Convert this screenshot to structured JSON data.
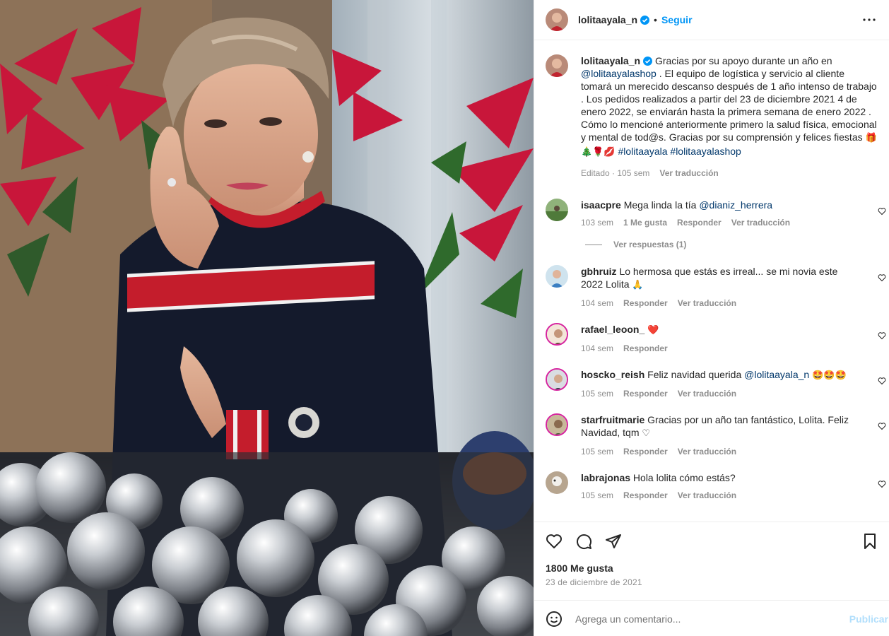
{
  "post": {
    "author": "lolitaayala_n",
    "follow_label": "Seguir",
    "separator": "•",
    "verified_icon": "verified-badge-icon",
    "more_icon": "more-options-icon"
  },
  "caption": {
    "username": "lolitaayala_n",
    "text_1": "Gracias por su apoyo durante un año en",
    "mention_1": "@lolitaayalashop",
    "text_2": ". El equipo de logística y servicio al cliente tomará un merecido descanso después de 1 año intenso de trabajo . Los pedidos realizados a partir del 23 de diciembre 2021 4 de enero 2022, se enviarán hasta la primera semana de enero 2022 . Cómo lo mencioné anteriormente primero la salud física, emocional y mental de tod@s. Gracias por su comprensión y felices fiestas",
    "emojis": "🎁🎄🌹💋",
    "hashtag_1": "#lolitaayala",
    "hashtag_2": "#lolitaayalashop",
    "edited": "Editado · 105 sem",
    "translate": "Ver traducción"
  },
  "comments": [
    {
      "username": "isaacpre",
      "text": "Mega linda la tía",
      "mention": "@dianiz_herrera",
      "emoji": "",
      "time": "103 sem",
      "likes": "1 Me gusta",
      "reply": "Responder",
      "translate": "Ver traducción"
    },
    {
      "username": "gbhruiz",
      "text": "Lo hermosa que estás es irreal... se mi novia este 2022 Lolita",
      "mention": "",
      "emoji": "🙏",
      "time": "104 sem",
      "likes": "",
      "reply": "Responder",
      "translate": "Ver traducción"
    },
    {
      "username": "rafael_leoon_",
      "text": "",
      "mention": "",
      "emoji": "❤️",
      "time": "104 sem",
      "likes": "",
      "reply": "Responder",
      "translate": ""
    },
    {
      "username": "hoscko_reish",
      "text": "Feliz navidad querida",
      "mention": "@lolitaayala_n",
      "emoji": "🤩🤩🤩",
      "time": "105 sem",
      "likes": "",
      "reply": "Responder",
      "translate": "Ver traducción"
    },
    {
      "username": "starfruitmarie",
      "text": "Gracias por un año tan fantástico, Lolita. Feliz Navidad, tqm",
      "mention": "",
      "emoji": "♡",
      "time": "105 sem",
      "likes": "",
      "reply": "Responder",
      "translate": "Ver traducción"
    },
    {
      "username": "labrajonas",
      "text": "Hola lolita cómo estás?",
      "mention": "",
      "emoji": "",
      "time": "105 sem",
      "likes": "",
      "reply": "Responder",
      "translate": "Ver traducción"
    }
  ],
  "view_replies": "Ver respuestas (1)",
  "footer": {
    "likes": "1800 Me gusta",
    "date": "23 de diciembre de 2021",
    "comment_placeholder": "Agrega un comentario...",
    "publish": "Publicar"
  },
  "colors": {
    "accent": "#0095f6",
    "link": "#00376b",
    "muted": "#8e8e8e",
    "like_red": "#ed4956"
  }
}
